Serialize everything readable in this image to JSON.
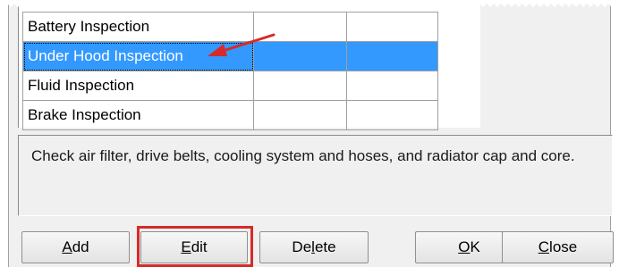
{
  "grid": {
    "rows": [
      {
        "label": "Battery Inspection",
        "selected": false
      },
      {
        "label": "Under Hood Inspection",
        "selected": true
      },
      {
        "label": "Fluid Inspection",
        "selected": false
      },
      {
        "label": "Brake Inspection",
        "selected": false
      }
    ]
  },
  "description": "Check air filter, drive belts, cooling system and hoses, and radiator cap and core.",
  "buttons": {
    "add": {
      "pre": "",
      "key": "A",
      "post": "dd"
    },
    "edit": {
      "pre": "",
      "key": "E",
      "post": "dit"
    },
    "delete": {
      "pre": "De",
      "key": "l",
      "post": "ete"
    },
    "ok": {
      "pre": "",
      "key": "O",
      "post": "K"
    },
    "close": {
      "pre": "",
      "key": "C",
      "post": "lose"
    }
  },
  "colors": {
    "selection": "#3399ff",
    "annotation_red": "#d62a2a"
  }
}
